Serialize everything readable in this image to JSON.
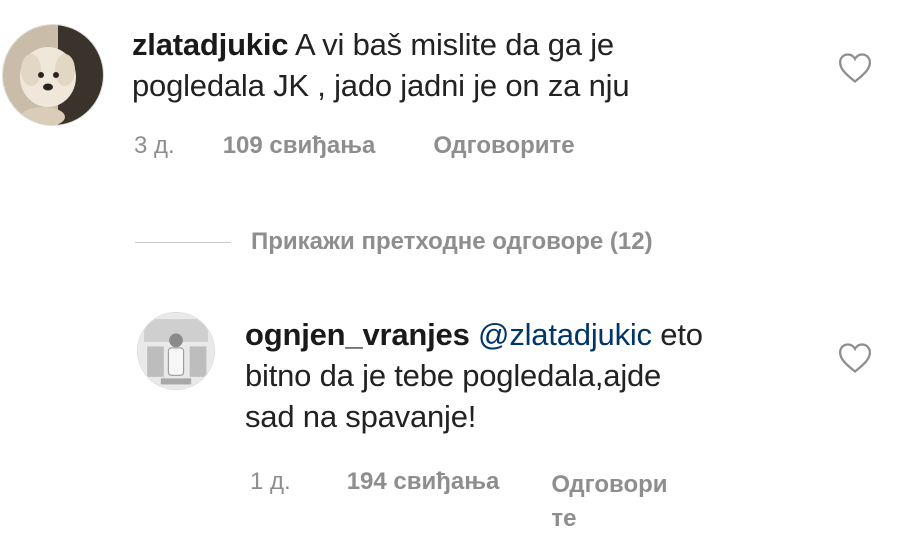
{
  "comment": {
    "username": "zlatadjukic",
    "text_line1": "A vi baš mislite da ga je",
    "text_line2": "pogledala JK , jado jadni je on za nju",
    "time": "3 д.",
    "likes": "109 свиђања",
    "reply": "Одговорите",
    "avatar_icon": "dog-avatar-icon",
    "like_icon": "heart-outline-icon"
  },
  "view_previous_replies": "Прикажи претходне одговоре (12)",
  "reply": {
    "username": "ognjen_vranjes",
    "mention": "@zlatadjukic",
    "text_line1_rest": "eto",
    "text_line2": "bitno da je tebe pogledala,ajde",
    "text_line3": "sad na spavanje!",
    "time": "1 д.",
    "likes": "194 свиђања",
    "reply_line1": "Одговори",
    "reply_line2": "те",
    "avatar_icon": "person-avatar-icon",
    "like_icon": "heart-outline-icon"
  },
  "colors": {
    "text": "#222222",
    "meta": "#8e8e8e",
    "mention": "#003569",
    "divider": "#c7c7c7"
  }
}
